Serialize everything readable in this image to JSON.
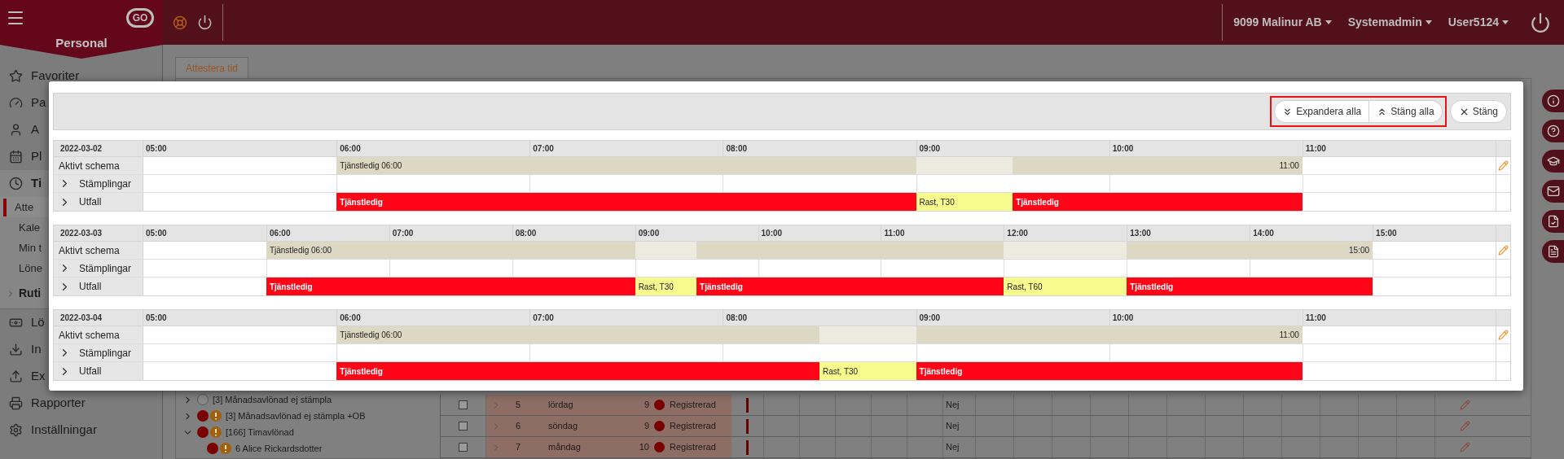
{
  "top_bar": {
    "logo": "GO",
    "module": "Personal",
    "menus": [
      {
        "label": "9099 Malinur AB"
      },
      {
        "label": "Systemadmin"
      },
      {
        "label": "User5124"
      }
    ]
  },
  "sidebar": {
    "items": [
      {
        "label": "Favoriter",
        "kind": "main",
        "selected": false
      },
      {
        "label": "Pa",
        "kind": "main",
        "selected": false
      },
      {
        "label": "A",
        "kind": "main",
        "selected": false
      },
      {
        "label": "Pl",
        "kind": "main",
        "selected": false
      },
      {
        "label": "Ti",
        "kind": "section",
        "selected": false
      },
      {
        "label": "Atte",
        "kind": "sub",
        "selected": true
      },
      {
        "label": "Kale",
        "kind": "sub",
        "selected": false
      },
      {
        "label": "Min t",
        "kind": "sub",
        "selected": false
      },
      {
        "label": "Löne",
        "kind": "sub",
        "selected": false
      },
      {
        "label": "Ruti",
        "kind": "group",
        "selected": false
      },
      {
        "label": "Lö",
        "kind": "main",
        "selected": false
      },
      {
        "label": "In",
        "kind": "main",
        "selected": false
      },
      {
        "label": "Ex",
        "kind": "main",
        "selected": false
      },
      {
        "label": "Rapporter",
        "kind": "main",
        "selected": false
      },
      {
        "label": "Inställningar",
        "kind": "main",
        "selected": false
      }
    ]
  },
  "tabs": [
    {
      "label": "Attestera tid",
      "selected": true
    }
  ],
  "tree": [
    {
      "label": "[3] Månadsavlönad ej stämpla",
      "alert": false,
      "expanded": false
    },
    {
      "label": "[3] Månadsavlönad ej stämpla +OB",
      "alert": true,
      "expanded": false
    },
    {
      "label": "[166] Timavlönad",
      "alert": true,
      "expanded": true,
      "children": [
        {
          "label": "6 Alice Rickardsdotter",
          "alert": true
        }
      ]
    }
  ],
  "table": {
    "rows": [
      {
        "checked": false,
        "cells": [
          "5",
          "lördag",
          "9",
          "Registrerad",
          "Nej"
        ]
      },
      {
        "checked": false,
        "cells": [
          "6",
          "söndag",
          "9",
          "Registrerad",
          "Nej"
        ]
      },
      {
        "checked": false,
        "cells": [
          "7",
          "måndag",
          "10",
          "Registrerad",
          "Nej"
        ]
      }
    ]
  },
  "modal": {
    "buttons": [
      {
        "label": "Expandera alla",
        "kind": "expand"
      },
      {
        "label": "Stäng alla",
        "kind": "collapse"
      },
      {
        "label": "Stäng",
        "kind": "close"
      }
    ],
    "days": [
      {
        "date": "2022-03-02",
        "hours": [
          "05:00",
          "06:00",
          "07:00",
          "08:00",
          "09:00",
          "10:00",
          "11:00"
        ],
        "schedule": {
          "label": "Aktivt schema",
          "start_label": "Tjänstledig 06:00",
          "end_label": "11:00",
          "slots": [
            {
              "kind": "free"
            },
            {
              "kind": "free"
            },
            {
              "kind": "shift"
            },
            {
              "kind": "shift"
            },
            {
              "kind": "shift"
            },
            {
              "kind": "shift"
            },
            {
              "kind": "shift"
            },
            {
              "kind": "shift"
            },
            {
              "kind": "break"
            },
            {
              "kind": "shift"
            },
            {
              "kind": "shift"
            },
            {
              "kind": "shift"
            },
            {
              "kind": "free"
            },
            {
              "kind": "free"
            }
          ]
        },
        "stamps": {
          "label": "Stämplingar",
          "expanded": false
        },
        "outcome": {
          "label": "Utfall",
          "expanded": false,
          "bar_labels": [
            "Tjänstledig",
            "Rast, T30",
            "Tjänstledig"
          ],
          "slots": [
            {
              "kind": "free"
            },
            {
              "kind": "free"
            },
            {
              "kind": "absence"
            },
            {
              "kind": "absence"
            },
            {
              "kind": "absence"
            },
            {
              "kind": "absence"
            },
            {
              "kind": "absence"
            },
            {
              "kind": "absence"
            },
            {
              "kind": "break"
            },
            {
              "kind": "absence"
            },
            {
              "kind": "absence"
            },
            {
              "kind": "absence"
            },
            {
              "kind": "free"
            },
            {
              "kind": "free"
            }
          ]
        }
      },
      {
        "date": "2022-03-03",
        "hours": [
          "05:00",
          "06:00",
          "07:00",
          "08:00",
          "09:00",
          "10:00",
          "11:00",
          "12:00",
          "13:00",
          "14:00",
          "15:00"
        ],
        "schedule": {
          "label": "Aktivt schema",
          "start_label": "Tjänstledig 06:00",
          "end_label": "15:00",
          "slots": [
            {
              "kind": "free"
            },
            {
              "kind": "free"
            },
            {
              "kind": "shift"
            },
            {
              "kind": "shift"
            },
            {
              "kind": "shift"
            },
            {
              "kind": "shift"
            },
            {
              "kind": "shift"
            },
            {
              "kind": "shift"
            },
            {
              "kind": "break"
            },
            {
              "kind": "shift"
            },
            {
              "kind": "shift"
            },
            {
              "kind": "shift"
            },
            {
              "kind": "shift"
            },
            {
              "kind": "shift"
            },
            {
              "kind": "break"
            },
            {
              "kind": "break"
            },
            {
              "kind": "shift"
            },
            {
              "kind": "shift"
            },
            {
              "kind": "shift"
            },
            {
              "kind": "shift"
            },
            {
              "kind": "free"
            },
            {
              "kind": "free"
            }
          ]
        },
        "stamps": {
          "label": "Stämplingar",
          "expanded": false
        },
        "outcome": {
          "label": "Utfall",
          "expanded": false,
          "bar_labels": [
            "Tjänstledig",
            "Rast, T30",
            "Tjänstledig",
            "Rast, T60",
            "Tjänstledig"
          ],
          "slots": [
            {
              "kind": "free"
            },
            {
              "kind": "free"
            },
            {
              "kind": "absence"
            },
            {
              "kind": "absence"
            },
            {
              "kind": "absence"
            },
            {
              "kind": "absence"
            },
            {
              "kind": "absence"
            },
            {
              "kind": "absence"
            },
            {
              "kind": "break"
            },
            {
              "kind": "absence"
            },
            {
              "kind": "absence"
            },
            {
              "kind": "absence"
            },
            {
              "kind": "absence"
            },
            {
              "kind": "absence"
            },
            {
              "kind": "break"
            },
            {
              "kind": "break"
            },
            {
              "kind": "absence"
            },
            {
              "kind": "absence"
            },
            {
              "kind": "absence"
            },
            {
              "kind": "absence"
            },
            {
              "kind": "free"
            },
            {
              "kind": "free"
            }
          ]
        }
      },
      {
        "date": "2022-03-04",
        "hours": [
          "05:00",
          "06:00",
          "07:00",
          "08:00",
          "09:00",
          "10:00",
          "11:00"
        ],
        "schedule": {
          "label": "Aktivt schema",
          "start_label": "Tjänstledig 06:00",
          "end_label": "11:00",
          "slots": [
            {
              "kind": "free"
            },
            {
              "kind": "free"
            },
            {
              "kind": "shift"
            },
            {
              "kind": "shift"
            },
            {
              "kind": "shift"
            },
            {
              "kind": "shift"
            },
            {
              "kind": "shift"
            },
            {
              "kind": "break"
            },
            {
              "kind": "shift"
            },
            {
              "kind": "shift"
            },
            {
              "kind": "shift"
            },
            {
              "kind": "shift"
            },
            {
              "kind": "free"
            },
            {
              "kind": "free"
            }
          ]
        },
        "stamps": {
          "label": "Stämplingar",
          "expanded": false
        },
        "outcome": {
          "label": "Utfall",
          "expanded": false,
          "bar_labels": [
            "Tjänstledig",
            "Rast, T30",
            "Tjänstledig"
          ],
          "slots": [
            {
              "kind": "free"
            },
            {
              "kind": "free"
            },
            {
              "kind": "absence"
            },
            {
              "kind": "absence"
            },
            {
              "kind": "absence"
            },
            {
              "kind": "absence"
            },
            {
              "kind": "absence"
            },
            {
              "kind": "break"
            },
            {
              "kind": "absence"
            },
            {
              "kind": "absence"
            },
            {
              "kind": "absence"
            },
            {
              "kind": "absence"
            },
            {
              "kind": "free"
            },
            {
              "kind": "free"
            }
          ]
        }
      }
    ]
  }
}
